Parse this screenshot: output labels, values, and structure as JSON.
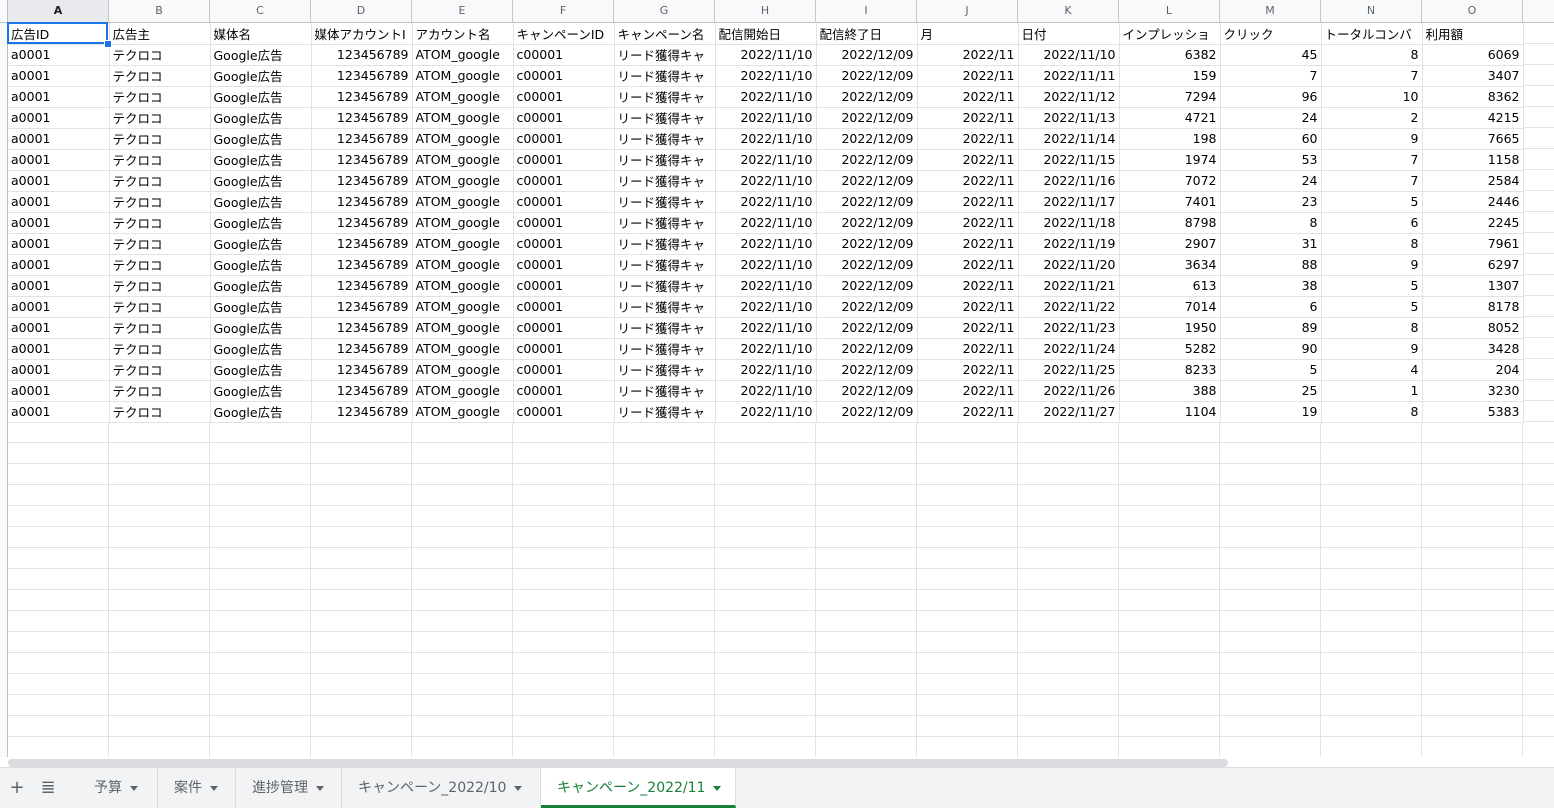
{
  "columns": [
    "A",
    "B",
    "C",
    "D",
    "E",
    "F",
    "G",
    "H",
    "I",
    "J",
    "K",
    "L",
    "M",
    "N",
    "O"
  ],
  "header_row": [
    "広告ID",
    "広告主",
    "媒体名",
    "媒体アカウントI",
    "アカウント名",
    "キャンペーンID",
    "キャンペーン名",
    "配信開始日",
    "配信終了日",
    "月",
    "日付",
    "インプレッショ",
    "クリック",
    "トータルコンバ",
    "利用額"
  ],
  "rows": [
    [
      "a0001",
      "テクロコ",
      "Google広告",
      "123456789",
      "ATOM_google",
      "c00001",
      "リード獲得キャ",
      "2022/11/10",
      "2022/12/09",
      "2022/11",
      "2022/11/10",
      "6382",
      "45",
      "8",
      "6069"
    ],
    [
      "a0001",
      "テクロコ",
      "Google広告",
      "123456789",
      "ATOM_google",
      "c00001",
      "リード獲得キャ",
      "2022/11/10",
      "2022/12/09",
      "2022/11",
      "2022/11/11",
      "159",
      "7",
      "7",
      "3407"
    ],
    [
      "a0001",
      "テクロコ",
      "Google広告",
      "123456789",
      "ATOM_google",
      "c00001",
      "リード獲得キャ",
      "2022/11/10",
      "2022/12/09",
      "2022/11",
      "2022/11/12",
      "7294",
      "96",
      "10",
      "8362"
    ],
    [
      "a0001",
      "テクロコ",
      "Google広告",
      "123456789",
      "ATOM_google",
      "c00001",
      "リード獲得キャ",
      "2022/11/10",
      "2022/12/09",
      "2022/11",
      "2022/11/13",
      "4721",
      "24",
      "2",
      "4215"
    ],
    [
      "a0001",
      "テクロコ",
      "Google広告",
      "123456789",
      "ATOM_google",
      "c00001",
      "リード獲得キャ",
      "2022/11/10",
      "2022/12/09",
      "2022/11",
      "2022/11/14",
      "198",
      "60",
      "9",
      "7665"
    ],
    [
      "a0001",
      "テクロコ",
      "Google広告",
      "123456789",
      "ATOM_google",
      "c00001",
      "リード獲得キャ",
      "2022/11/10",
      "2022/12/09",
      "2022/11",
      "2022/11/15",
      "1974",
      "53",
      "7",
      "1158"
    ],
    [
      "a0001",
      "テクロコ",
      "Google広告",
      "123456789",
      "ATOM_google",
      "c00001",
      "リード獲得キャ",
      "2022/11/10",
      "2022/12/09",
      "2022/11",
      "2022/11/16",
      "7072",
      "24",
      "7",
      "2584"
    ],
    [
      "a0001",
      "テクロコ",
      "Google広告",
      "123456789",
      "ATOM_google",
      "c00001",
      "リード獲得キャ",
      "2022/11/10",
      "2022/12/09",
      "2022/11",
      "2022/11/17",
      "7401",
      "23",
      "5",
      "2446"
    ],
    [
      "a0001",
      "テクロコ",
      "Google広告",
      "123456789",
      "ATOM_google",
      "c00001",
      "リード獲得キャ",
      "2022/11/10",
      "2022/12/09",
      "2022/11",
      "2022/11/18",
      "8798",
      "8",
      "6",
      "2245"
    ],
    [
      "a0001",
      "テクロコ",
      "Google広告",
      "123456789",
      "ATOM_google",
      "c00001",
      "リード獲得キャ",
      "2022/11/10",
      "2022/12/09",
      "2022/11",
      "2022/11/19",
      "2907",
      "31",
      "8",
      "7961"
    ],
    [
      "a0001",
      "テクロコ",
      "Google広告",
      "123456789",
      "ATOM_google",
      "c00001",
      "リード獲得キャ",
      "2022/11/10",
      "2022/12/09",
      "2022/11",
      "2022/11/20",
      "3634",
      "88",
      "9",
      "6297"
    ],
    [
      "a0001",
      "テクロコ",
      "Google広告",
      "123456789",
      "ATOM_google",
      "c00001",
      "リード獲得キャ",
      "2022/11/10",
      "2022/12/09",
      "2022/11",
      "2022/11/21",
      "613",
      "38",
      "5",
      "1307"
    ],
    [
      "a0001",
      "テクロコ",
      "Google広告",
      "123456789",
      "ATOM_google",
      "c00001",
      "リード獲得キャ",
      "2022/11/10",
      "2022/12/09",
      "2022/11",
      "2022/11/22",
      "7014",
      "6",
      "5",
      "8178"
    ],
    [
      "a0001",
      "テクロコ",
      "Google広告",
      "123456789",
      "ATOM_google",
      "c00001",
      "リード獲得キャ",
      "2022/11/10",
      "2022/12/09",
      "2022/11",
      "2022/11/23",
      "1950",
      "89",
      "8",
      "8052"
    ],
    [
      "a0001",
      "テクロコ",
      "Google広告",
      "123456789",
      "ATOM_google",
      "c00001",
      "リード獲得キャ",
      "2022/11/10",
      "2022/12/09",
      "2022/11",
      "2022/11/24",
      "5282",
      "90",
      "9",
      "3428"
    ],
    [
      "a0001",
      "テクロコ",
      "Google広告",
      "123456789",
      "ATOM_google",
      "c00001",
      "リード獲得キャ",
      "2022/11/10",
      "2022/12/09",
      "2022/11",
      "2022/11/25",
      "8233",
      "5",
      "4",
      "204"
    ],
    [
      "a0001",
      "テクロコ",
      "Google広告",
      "123456789",
      "ATOM_google",
      "c00001",
      "リード獲得キャ",
      "2022/11/10",
      "2022/12/09",
      "2022/11",
      "2022/11/26",
      "388",
      "25",
      "1",
      "3230"
    ],
    [
      "a0001",
      "テクロコ",
      "Google広告",
      "123456789",
      "ATOM_google",
      "c00001",
      "リード獲得キャ",
      "2022/11/10",
      "2022/12/09",
      "2022/11",
      "2022/11/27",
      "1104",
      "19",
      "8",
      "5383"
    ]
  ],
  "numeric_columns": [
    3,
    7,
    8,
    9,
    10,
    11,
    12,
    13,
    14
  ],
  "selected_column": "A",
  "tabs": [
    "予算",
    "案件",
    "進捗管理",
    "キャンペーン_2022/10",
    "キャンペーン_2022/11"
  ],
  "active_tab": 4,
  "toolbar": {
    "add": "+",
    "list": "≣"
  },
  "colors": {
    "accent": "#1a73e8",
    "active_tab": "#188038"
  }
}
